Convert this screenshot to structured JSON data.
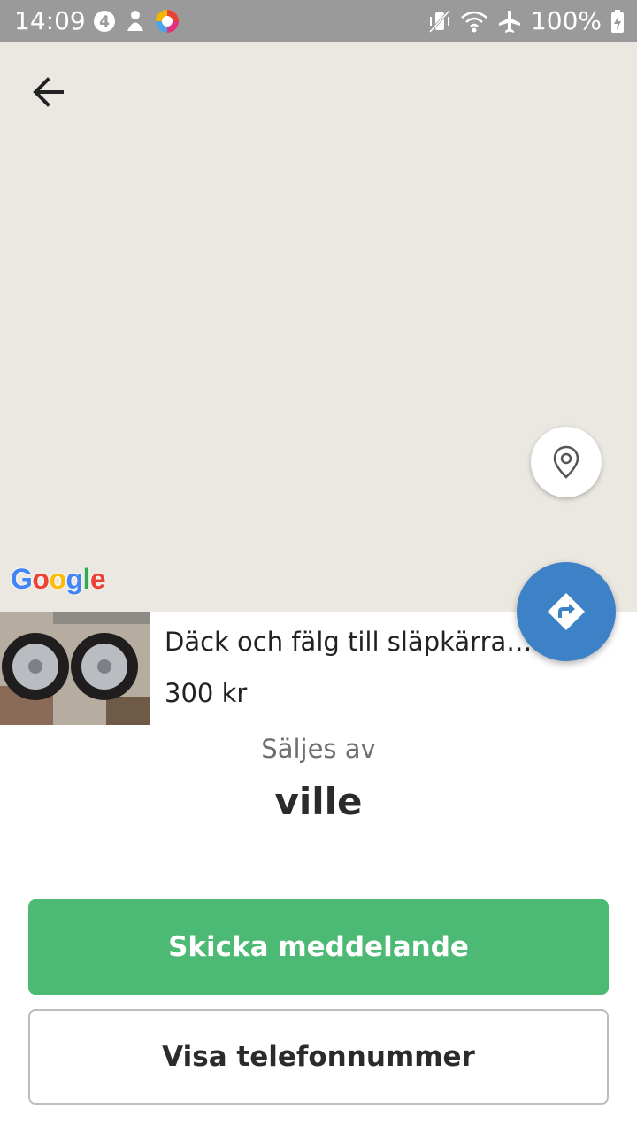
{
  "status_bar": {
    "time": "14:09",
    "battery": "100%",
    "left_icons": [
      "notification-4-icon",
      "app-notification-icon",
      "browser-icon"
    ],
    "right_icons": [
      "vibrate-icon",
      "wifi-icon",
      "airplane-icon",
      "battery-charging-icon"
    ]
  },
  "map": {
    "google_logo": "Google",
    "background_color": "#ebe8e2"
  },
  "listing": {
    "title": "Däck och fälg till släpkärra. 1...",
    "price": "300 kr"
  },
  "seller": {
    "label": "Säljes av",
    "name": "ville"
  },
  "actions": {
    "send_message": "Skicka meddelande",
    "show_phone": "Visa telefonnummer"
  },
  "colors": {
    "primary_green": "#4cb974",
    "directions_blue": "#3d81c7",
    "status_bar": "#9a9a9a"
  }
}
